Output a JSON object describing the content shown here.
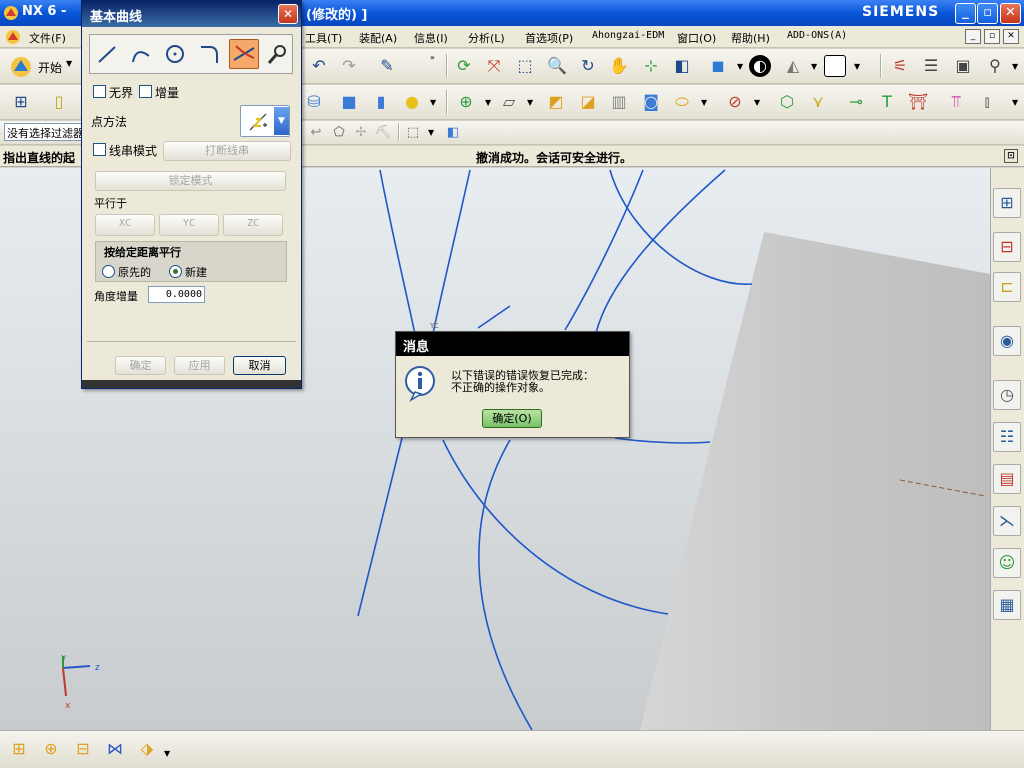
{
  "window": {
    "title": "NX 6 -",
    "title_modified": "(修改的)  ]",
    "brand": "SIEMENS"
  },
  "menubar": {
    "items": [
      "文件(F)",
      "工具(T)",
      "装配(A)",
      "信息(I)",
      "分析(L)",
      "首选项(P)",
      "Ahongzai-EDM",
      "窗口(O)",
      "帮助(H)",
      "ADD-ONS(A)"
    ]
  },
  "toolbar": {
    "start_label": "开始",
    "selection_filter": "没有选择过滤器"
  },
  "cue_line": {
    "prompt": "指出直线的起",
    "status": "撤消成功。会话可安全进行。"
  },
  "dialog": {
    "title": "基本曲线",
    "unbounded_label": "无界",
    "incremental_label": "增量",
    "point_method_label": "点方法",
    "string_mode_label": "线串模式",
    "break_string_label": "打断线串",
    "lock_mode_label": "锁定模式",
    "parallel_to_label": "平行于",
    "xc_label": "XC",
    "yc_label": "YC",
    "zc_label": "ZC",
    "offset_group_label": "按给定距离平行",
    "original_label": "原先的",
    "new_label": "新建",
    "angle_increment_label": "角度增量",
    "angle_increment_value": "0.0000",
    "ok_label": "确定",
    "apply_label": "应用",
    "cancel_label": "取消"
  },
  "message_box": {
    "title": "消息",
    "line1": "以下错误的错误恢复已完成：",
    "line2": "不正确的操作对象。",
    "ok_label": "确定(O)"
  },
  "triad": {
    "y": "y",
    "z": "z",
    "x": "x"
  },
  "viewport_label": "YC",
  "colors": {
    "title_bar": "#0a56d8",
    "curve": "#1f57c9",
    "sheet_body": "#c9c9c9",
    "viewport_top": "#e8edf1",
    "dialog_bg": "#ece9d8"
  }
}
